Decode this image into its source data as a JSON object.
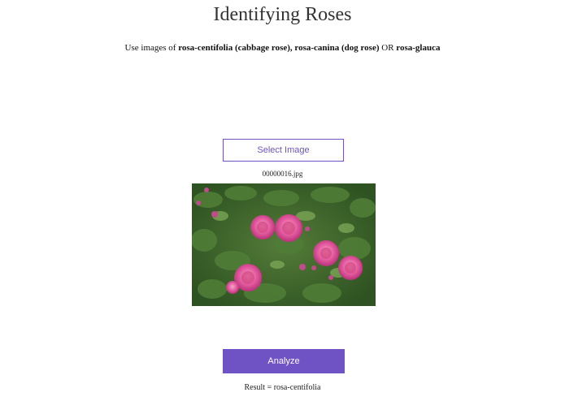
{
  "page": {
    "title": "Identifying Roses",
    "instruction": {
      "prefix": "Use images of ",
      "option_1": "rosa-centifolia (cabbage rose), rosa-canina (dog rose)",
      "separator": " OR ",
      "option_2": "rosa-glauca"
    }
  },
  "upload": {
    "select_label": "Select Image",
    "filename": "00000016.jpg"
  },
  "image": {
    "description_icon": "rose-photo"
  },
  "analyze": {
    "button_label": "Analyze",
    "result_text": "Result = rosa-centifolia"
  },
  "colors": {
    "accent": "#6f52c4",
    "rose_pink": "#e0559a",
    "foliage": "#3f6e2f"
  }
}
